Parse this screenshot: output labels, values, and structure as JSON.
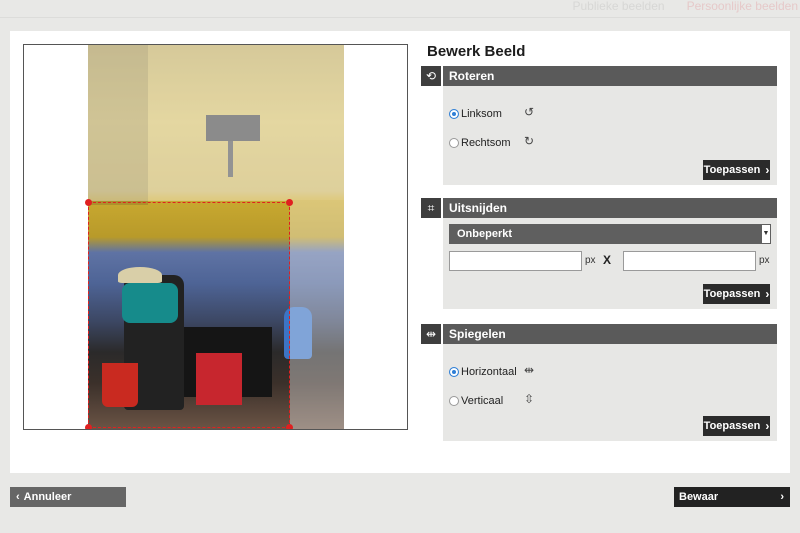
{
  "background": {
    "tabs": [
      "Publieke beelden",
      "Persoonlijke beelden"
    ]
  },
  "panel": {
    "title": "Bewerk Beeld"
  },
  "rotate": {
    "title": "Roteren",
    "icon": "rotate-icon",
    "options": [
      {
        "label": "Linksom",
        "selected": true,
        "icon": "rotate-left-icon"
      },
      {
        "label": "Rechtsom",
        "selected": false,
        "icon": "rotate-right-icon"
      }
    ],
    "apply_label": "Toepassen"
  },
  "crop": {
    "title": "Uitsnijden",
    "icon": "crop-icon",
    "select_value": "Onbeperkt",
    "width_value": "",
    "height_value": "",
    "unit": "px",
    "separator": "X",
    "apply_label": "Toepassen"
  },
  "mirror": {
    "title": "Spiegelen",
    "icon": "flip-icon",
    "options": [
      {
        "label": "Horizontaal",
        "selected": true,
        "icon": "flip-horizontal-icon"
      },
      {
        "label": "Verticaal",
        "selected": false,
        "icon": "flip-vertical-icon"
      }
    ],
    "apply_label": "Toepassen"
  },
  "footer": {
    "cancel_label": "Annuleer",
    "save_label": "Bewaar"
  },
  "colors": {
    "accent_radio": "#2f7fd6",
    "crop_border": "#e02020",
    "section_header": "#5a5a5a",
    "button_dark": "#2b2b2b"
  }
}
